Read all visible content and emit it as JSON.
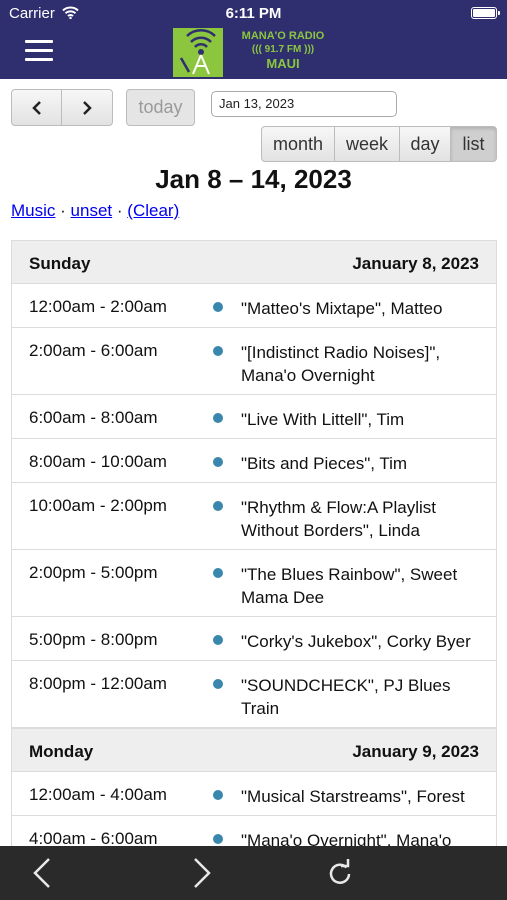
{
  "status_bar": {
    "carrier": "Carrier",
    "time": "6:11 PM"
  },
  "header": {
    "logo_line1": "MANA'O RADIO",
    "logo_line2": "((( 91.7 FM )))",
    "logo_line3": "MAUI"
  },
  "toolbar": {
    "today_label": "today",
    "date_value": "Jan 13, 2023",
    "views": [
      "month",
      "week",
      "day",
      "list"
    ],
    "active_view": "list"
  },
  "range_title": "Jan 8 – 14, 2023",
  "filters": {
    "music": "Music",
    "sep1": "·",
    "unset": "unset",
    "sep2": "·",
    "clear": "(Clear)"
  },
  "days": [
    {
      "name": "Sunday",
      "date": "January 8, 2023",
      "events": [
        {
          "time": "12:00am - 2:00am",
          "title": "\"Matteo's Mixtape\", Matteo"
        },
        {
          "time": "2:00am - 6:00am",
          "title": "\"[Indistinct Radio Noises]\", Mana'o Overnight"
        },
        {
          "time": "6:00am - 8:00am",
          "title": "\"Live With Littell\", Tim"
        },
        {
          "time": "8:00am - 10:00am",
          "title": "\"Bits and Pieces\", Tim"
        },
        {
          "time": "10:00am - 2:00pm",
          "title": "\"Rhythm & Flow:A Playlist Without Borders\", Linda"
        },
        {
          "time": "2:00pm - 5:00pm",
          "title": "\"The Blues Rainbow\", Sweet Mama Dee"
        },
        {
          "time": "5:00pm - 8:00pm",
          "title": "\"Corky's Jukebox\", Corky Byer"
        },
        {
          "time": "8:00pm - 12:00am",
          "title": "\"SOUNDCHECK\", PJ Blues Train"
        }
      ]
    },
    {
      "name": "Monday",
      "date": "January 9, 2023",
      "events": [
        {
          "time": "12:00am - 4:00am",
          "title": "\"Musical Starstreams\", Forest"
        },
        {
          "time": "4:00am - 6:00am",
          "title": "\"Mana'o Overnight\", Mana'o"
        }
      ]
    }
  ],
  "colors": {
    "header_bg": "#2f2e6e",
    "logo_green": "#8cc63f",
    "event_dot": "#3a87ad",
    "day_header_bg": "#eeeeee",
    "bottom_bar_bg": "#2a2a2a"
  },
  "icons": {
    "menu": "hamburger-icon",
    "prev": "chevron-left-icon",
    "next": "chevron-right-icon",
    "back": "back-arrow-icon",
    "forward": "forward-arrow-icon",
    "reload": "reload-icon"
  }
}
